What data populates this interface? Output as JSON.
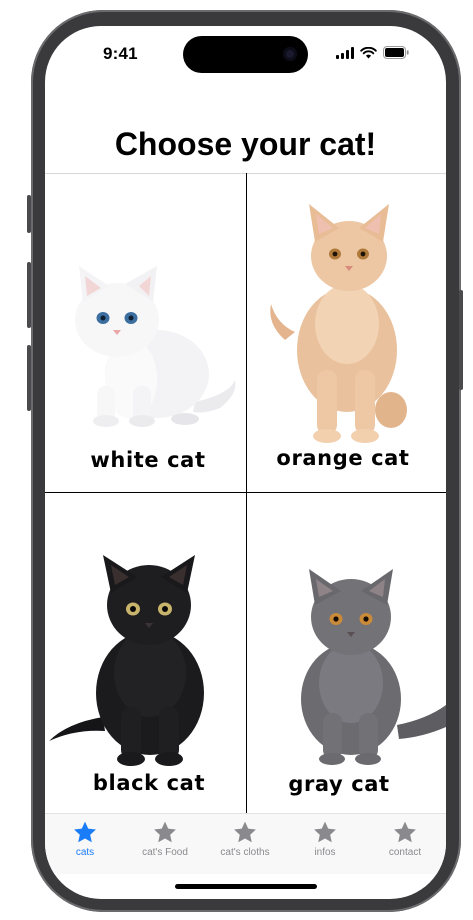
{
  "status": {
    "time": "9:41"
  },
  "title": "Choose your cat!",
  "cats": [
    {
      "label": "white cat",
      "icon": "white-kitten-photo"
    },
    {
      "label": "orange cat",
      "icon": "orange-kitten-photo"
    },
    {
      "label": "black cat",
      "icon": "black-kitten-photo"
    },
    {
      "label": "gray cat",
      "icon": "gray-kitten-photo"
    }
  ],
  "tabs": [
    {
      "label": "cats",
      "icon": "star-icon",
      "active": true
    },
    {
      "label": "cat's Food",
      "icon": "star-icon",
      "active": false
    },
    {
      "label": "cat's cloths",
      "icon": "star-icon",
      "active": false
    },
    {
      "label": "infos",
      "icon": "star-icon",
      "active": false
    },
    {
      "label": "contact",
      "icon": "star-icon",
      "active": false
    }
  ],
  "colors": {
    "accent": "#1a7cf6",
    "inactive": "#8a8a8e"
  }
}
